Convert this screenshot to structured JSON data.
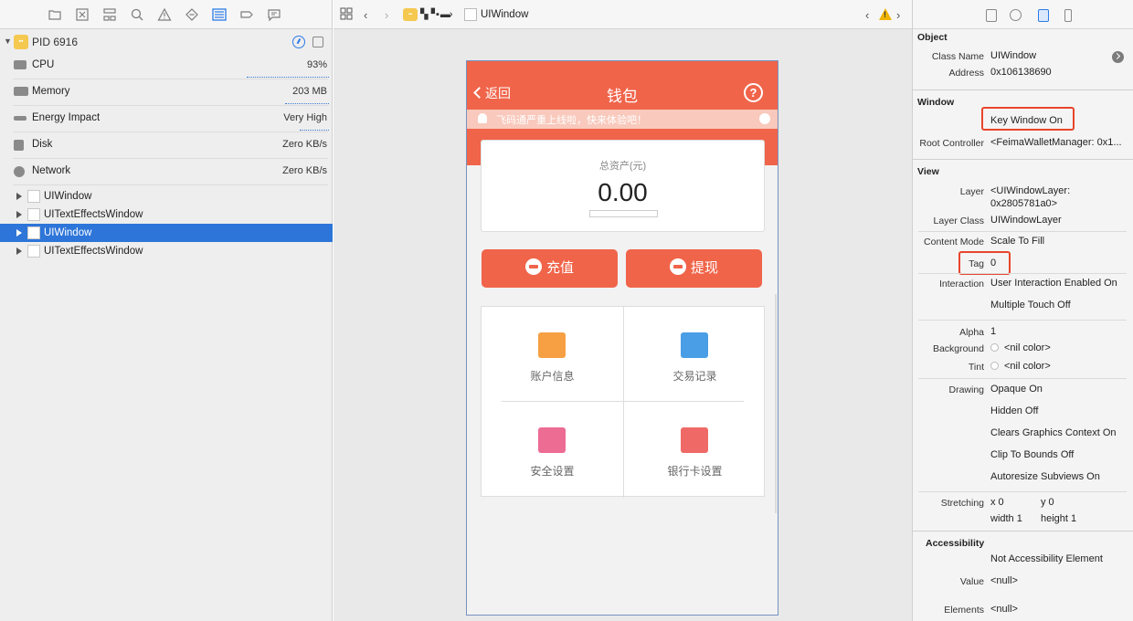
{
  "navigator": {
    "process": {
      "name": "PID 6916",
      "icon": "app-icon"
    },
    "gauges": [
      {
        "label": "CPU",
        "value": "93%",
        "icon": "cpu-icon"
      },
      {
        "label": "Memory",
        "value": "203 MB",
        "icon": "memory-icon"
      },
      {
        "label": "Energy Impact",
        "value": "Very High",
        "icon": "energy-icon"
      },
      {
        "label": "Disk",
        "value": "Zero KB/s",
        "icon": "disk-icon"
      },
      {
        "label": "Network",
        "value": "Zero KB/s",
        "icon": "network-icon"
      }
    ],
    "tree": [
      {
        "label": "UIWindow",
        "selected": false
      },
      {
        "label": "UITextEffectsWindow",
        "selected": false
      },
      {
        "label": "UIWindow",
        "selected": true
      },
      {
        "label": "UITextEffectsWindow",
        "selected": false
      }
    ],
    "toolbar_icons": [
      "folder-icon",
      "x-box-icon",
      "hierarchy-icon",
      "search-icon",
      "warning-icon",
      "diamond-icon",
      "debug-icon",
      "tag-icon",
      "chat-icon"
    ]
  },
  "jumpbar": {
    "title": "UIWindow",
    "warning": "!"
  },
  "phone": {
    "nav_back": "返回",
    "nav_title": "钱包",
    "help": "?",
    "notice": "飞码通严重上线啦，快来体验吧！",
    "card_label": "总资产(元)",
    "amount": "0.00",
    "recharge": "充值",
    "withdraw": "提现",
    "grid": [
      "账户信息",
      "交易记录",
      "安全设置",
      "银行卡设置"
    ]
  },
  "inspector": {
    "object_header": "Object",
    "class_name_key": "Class Name",
    "class_name": "UIWindow",
    "address_key": "Address",
    "address": "0x106138690",
    "window_header": "Window",
    "key_window": "Key Window On",
    "root_controller_key": "Root Controller",
    "root_controller": "<FeimaWalletManager: 0x1...",
    "view_header": "View",
    "layer_key": "Layer",
    "layer_line1": "<UIWindowLayer:",
    "layer_line2": "0x2805781a0>",
    "layer_class_key": "Layer Class",
    "layer_class": "UIWindowLayer",
    "content_mode_key": "Content Mode",
    "content_mode": "Scale To Fill",
    "tag_key": "Tag",
    "tag": "0",
    "interaction_key": "Interaction",
    "interaction1": "User Interaction Enabled On",
    "interaction2": "Multiple Touch Off",
    "alpha_key": "Alpha",
    "alpha": "1",
    "background_key": "Background",
    "background": "<nil color>",
    "tint_key": "Tint",
    "tint": "<nil color>",
    "drawing_key": "Drawing",
    "drawing": [
      "Opaque On",
      "Hidden Off",
      "Clears Graphics Context On",
      "Clip To Bounds Off",
      "Autoresize Subviews On"
    ],
    "stretching_key": "Stretching",
    "stretch_x": "x 0",
    "stretch_y": "y 0",
    "stretch_w": "width 1",
    "stretch_h": "height 1",
    "accessibility_header": "Accessibility",
    "accessibility": "Not Accessibility Element",
    "value_key": "Value",
    "value": "<null>",
    "elements_key": "Elements",
    "elements": "<null>"
  },
  "colors": {
    "accent": "#2c7be5",
    "brand": "#f0644a",
    "highlight": "#e8452c"
  }
}
